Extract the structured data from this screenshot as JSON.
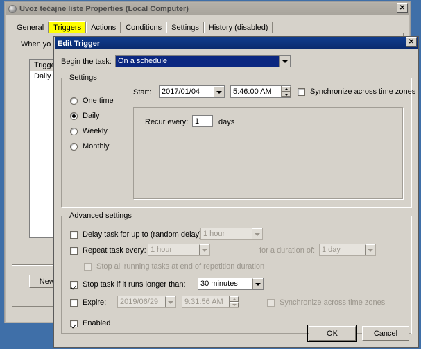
{
  "parent_window": {
    "title": "Uvoz tečajne liste Properties (Local Computer)",
    "close_label": "✕",
    "tabs": [
      {
        "label": "General",
        "selected": false
      },
      {
        "label": "Triggers",
        "selected": true
      },
      {
        "label": "Actions",
        "selected": false
      },
      {
        "label": "Conditions",
        "selected": false
      },
      {
        "label": "Settings",
        "selected": false
      },
      {
        "label": "History (disabled)",
        "selected": false
      }
    ],
    "description": "When yo",
    "list": {
      "columns": [
        "Trigger"
      ],
      "rows": [
        [
          "Daily"
        ]
      ]
    },
    "new_button": "New."
  },
  "dialog": {
    "title": "Edit Trigger",
    "close_label": "✕",
    "begin_task": {
      "label": "Begin the task:",
      "value": "On a schedule"
    },
    "settings": {
      "group_title": "Settings",
      "radios": [
        {
          "label": "One time",
          "checked": false
        },
        {
          "label": "Daily",
          "checked": true
        },
        {
          "label": "Weekly",
          "checked": false
        },
        {
          "label": "Monthly",
          "checked": false
        }
      ],
      "start_label": "Start:",
      "start_date": "2017/01/04",
      "start_time": "5:46:00 AM",
      "sync_label": "Synchronize across time zones",
      "sync_checked": false,
      "recur_label": "Recur every:",
      "recur_value": "1",
      "recur_unit": "days"
    },
    "advanced": {
      "group_title": "Advanced settings",
      "delay_label": "Delay task for up to (random delay):",
      "delay_checked": false,
      "delay_value": "1 hour",
      "repeat_label": "Repeat task every:",
      "repeat_checked": false,
      "repeat_value": "1 hour",
      "duration_label": "for a duration of:",
      "duration_value": "1 day",
      "stop_all_label": "Stop all running tasks at end of repetition duration",
      "stop_all_checked": false,
      "stop_task_label": "Stop task if it runs longer than:",
      "stop_task_checked": true,
      "stop_task_value": "30 minutes",
      "expire_label": "Expire:",
      "expire_checked": false,
      "expire_date": "2019/06/29",
      "expire_time": "9:31:56 AM",
      "expire_sync_label": "Synchronize across time zones",
      "expire_sync_checked": false,
      "enabled_label": "Enabled",
      "enabled_checked": true
    },
    "buttons": {
      "ok": "OK",
      "cancel": "Cancel"
    }
  },
  "colors": {
    "desktop": "#3f6fa8",
    "window_face": "#d6d2ca",
    "active_title": "#0a2a6e",
    "inactive_title": "#a8a49c",
    "tab_highlight": "#ffff00",
    "selection": "#0b2780"
  }
}
